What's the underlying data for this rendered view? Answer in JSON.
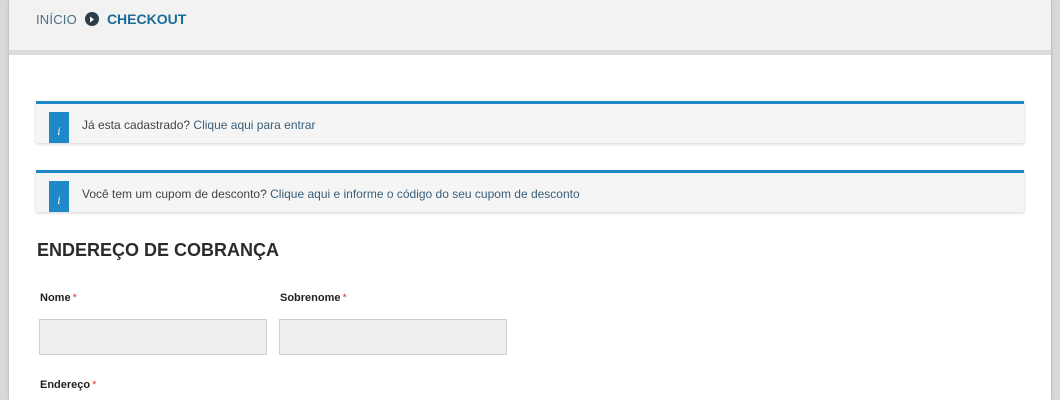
{
  "breadcrumb": {
    "home_label": "INÍCIO",
    "separator_icon": "circle-arrow-right-icon",
    "current_label": "CHECKOUT"
  },
  "notices": {
    "login": {
      "icon": "info-icon",
      "icon_glyph": "i",
      "prefix": "Já esta cadastrado?",
      "link_label": "Clique aqui para entrar"
    },
    "coupon": {
      "icon": "info-icon",
      "icon_glyph": "i",
      "prefix": "Você tem um cupom de desconto?",
      "link_label": "Clique aqui e informe o código do seu cupom de desconto"
    }
  },
  "billing": {
    "title": "ENDEREÇO DE COBRANÇA",
    "required_marker": "*",
    "fields": {
      "first_name": {
        "label": "Nome",
        "value": ""
      },
      "last_name": {
        "label": "Sobrenome",
        "value": ""
      },
      "address": {
        "label": "Endereço"
      }
    }
  },
  "colors": {
    "accent": "#1e88c8",
    "breadcrumb_current": "#1b6b99",
    "required": "#e03b3b",
    "input_bg": "#eeeeee"
  }
}
